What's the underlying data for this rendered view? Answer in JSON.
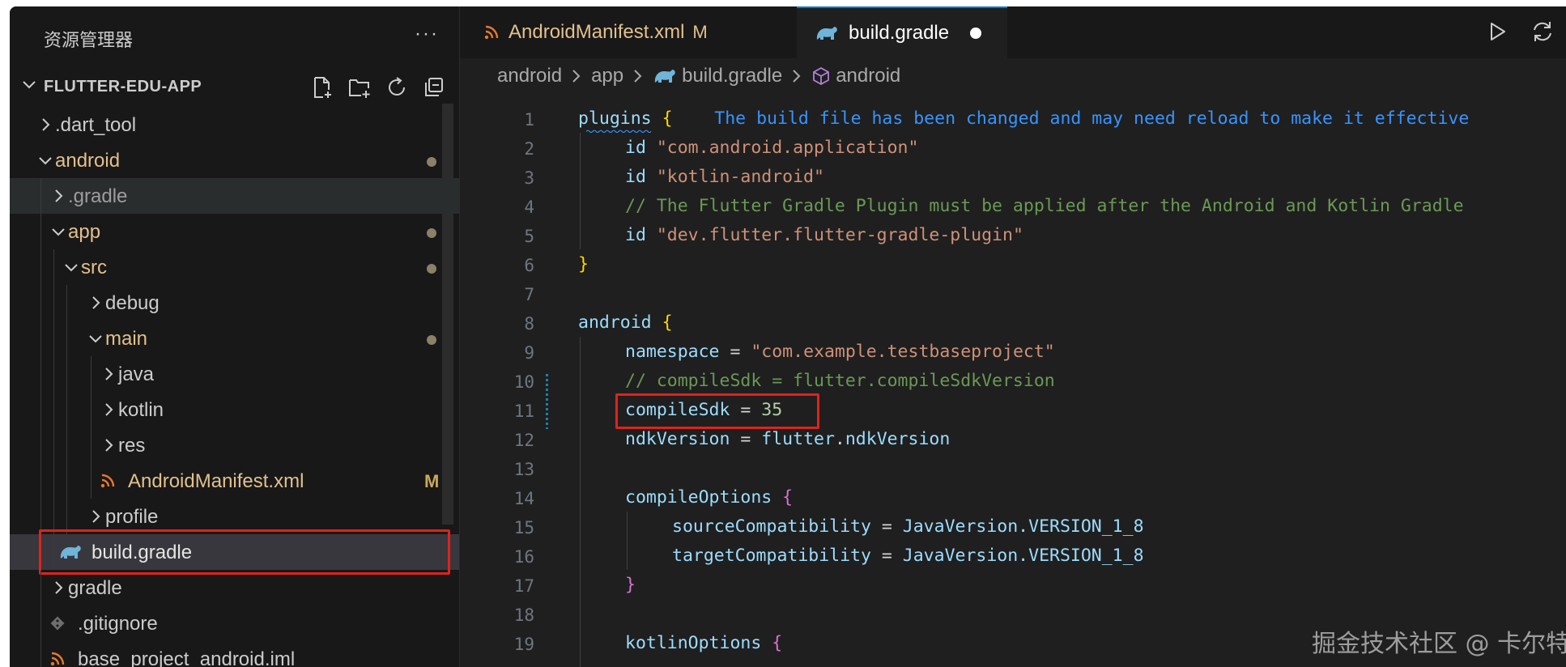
{
  "sidebar": {
    "title": "资源管理器",
    "more": "···",
    "project": "FLUTTER-EDU-APP",
    "items": [
      {
        "label": ".dart_tool"
      },
      {
        "label": "android"
      },
      {
        "label": ".gradle"
      },
      {
        "label": "app"
      },
      {
        "label": "src"
      },
      {
        "label": "debug"
      },
      {
        "label": "main"
      },
      {
        "label": "java"
      },
      {
        "label": "kotlin"
      },
      {
        "label": "res"
      },
      {
        "label": "AndroidManifest.xml",
        "badge": "M"
      },
      {
        "label": "profile"
      },
      {
        "label": "build.gradle"
      },
      {
        "label": "gradle"
      },
      {
        "label": ".gitignore"
      },
      {
        "label": "base_project_android.iml"
      }
    ]
  },
  "tabs": [
    {
      "label": "AndroidManifest.xml",
      "badge": "M"
    },
    {
      "label": "build.gradle"
    }
  ],
  "breadcrumb": [
    "android",
    "app",
    "build.gradle",
    "android"
  ],
  "editor": {
    "line_numbers": [
      "1",
      "2",
      "3",
      "4",
      "5",
      "6",
      "7",
      "8",
      "9",
      "10",
      "11",
      "12",
      "13",
      "14",
      "15",
      "16",
      "17",
      "18",
      "19"
    ],
    "lines": {
      "l1a": "plugins",
      "l1b": "{",
      "l1msg": "The build file has been changed and may need reload to make it effective",
      "l2a": "id",
      "l2b": "\"com.android.application\"",
      "l3a": "id",
      "l3b": "\"kotlin-android\"",
      "l4": "// The Flutter Gradle Plugin must be applied after the Android and Kotlin Gradle",
      "l5a": "id",
      "l5b": "\"dev.flutter.flutter-gradle-plugin\"",
      "l6": "}",
      "l8a": "android",
      "l8b": "{",
      "l9a": "namespace",
      "l9b": " = ",
      "l9c": "\"com.example.testbaseproject\"",
      "l10": "// compileSdk = flutter.compileSdkVersion",
      "l11a": "compileSdk",
      "l11b": " = ",
      "l11c": "35",
      "l12a": "ndkVersion",
      "l12b": " = ",
      "l12c": "flutter",
      "l12d": ".",
      "l12e": "ndkVersion",
      "l14a": "compileOptions",
      "l14b": "{",
      "l15a": "sourceCompatibility",
      "l15b": " = ",
      "l15c": "JavaVersion.VERSION_1_8",
      "l16a": "targetCompatibility",
      "l16b": " = ",
      "l16c": "JavaVersion.VERSION_1_8",
      "l17": "}",
      "l19a": "kotlinOptions",
      "l19b": "{"
    }
  },
  "watermark": "掘金技术社区 @ 卡尔特斯"
}
